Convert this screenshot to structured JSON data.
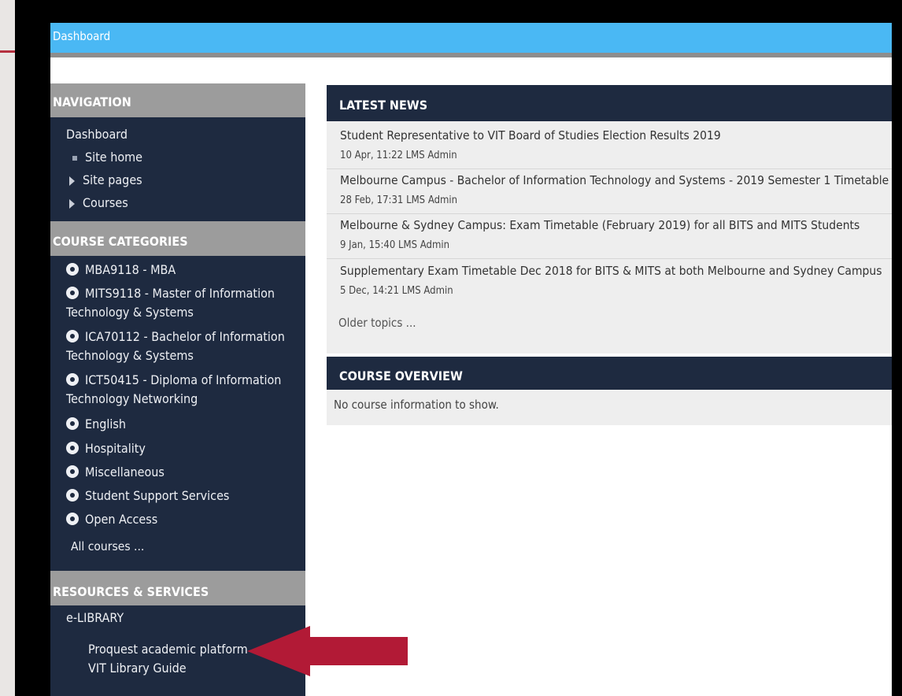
{
  "topbar": {
    "title": "Dashboard"
  },
  "navigation": {
    "header": "NAVIGATION",
    "dashboard": "Dashboard",
    "items": [
      "Site home",
      "Site pages",
      "Courses"
    ]
  },
  "course_categories": {
    "header": "COURSE CATEGORIES",
    "items": [
      "MBA9118 - MBA",
      "MITS9118 - Master of Information Technology & Systems",
      "ICA70112 - Bachelor of Information Technology & Systems",
      "ICT50415 - Diploma of Information Technology Networking",
      "English",
      "Hospitality",
      "Miscellaneous",
      "Student Support Services",
      "Open Access"
    ],
    "all_courses": "All courses ..."
  },
  "resources": {
    "header": "RESOURCES & SERVICES",
    "elibrary": "e-LIBRARY",
    "links": [
      "Proquest academic platform",
      "VIT Library Guide"
    ]
  },
  "latest_news": {
    "header": "LATEST NEWS",
    "items": [
      {
        "title": "Student Representative to VIT Board of Studies Election Results 2019",
        "meta": "10 Apr, 11:22 LMS Admin"
      },
      {
        "title": "Melbourne Campus - Bachelor of Information Technology and Systems - 2019 Semester 1 Timetable",
        "meta": "28 Feb, 17:31 LMS Admin"
      },
      {
        "title": "Melbourne & Sydney Campus: Exam Timetable (February 2019) for all BITS and MITS Students",
        "meta": "9 Jan, 15:40 LMS Admin"
      },
      {
        "title": "Supplementary Exam Timetable Dec 2018 for BITS & MITS at both Melbourne and Sydney Campus",
        "meta": "5 Dec, 14:21 LMS Admin"
      }
    ],
    "older": "Older topics ..."
  },
  "course_overview": {
    "header": "COURSE OVERVIEW",
    "empty": "No course information to show."
  },
  "colors": {
    "topbar": "#4ab8f4",
    "navy": "#1e2a40",
    "block_header_gray": "#9c9c9c",
    "arrow": "#b21a36"
  }
}
